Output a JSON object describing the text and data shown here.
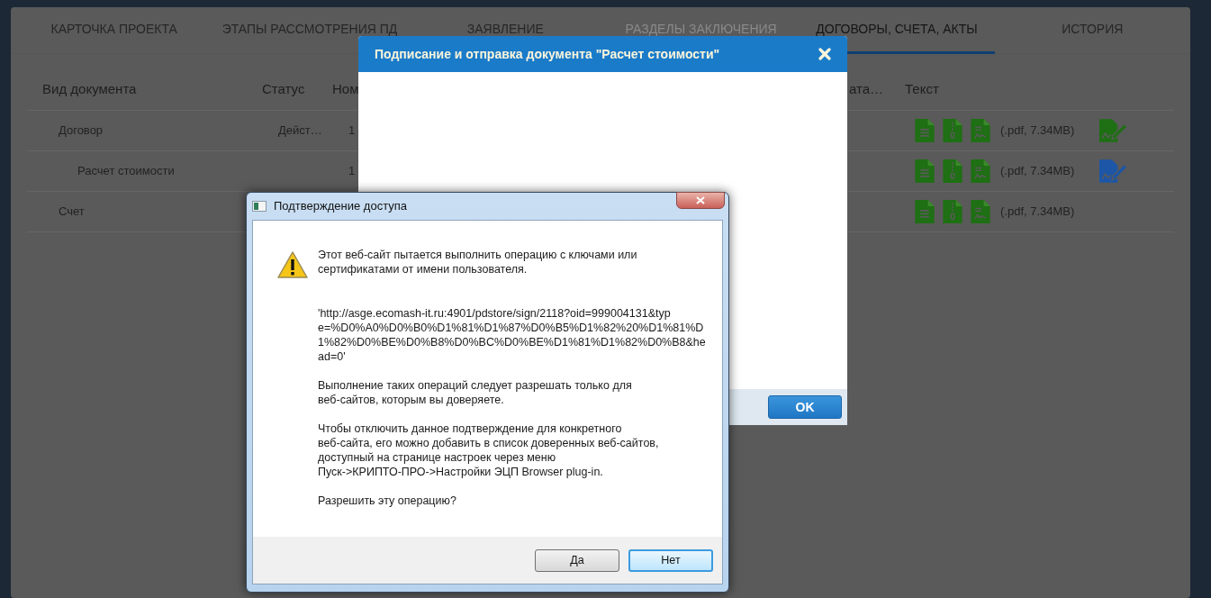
{
  "tabs": [
    {
      "label": "КАРТОЧКА ПРОЕКТА",
      "selected": false,
      "disabled": false
    },
    {
      "label": "ЭТАПЫ РАССМОТРЕНИЯ ПД",
      "selected": false,
      "disabled": false
    },
    {
      "label": "ЗАЯВЛЕНИЕ",
      "selected": false,
      "disabled": false
    },
    {
      "label": "РАЗДЕЛЫ ЗАКЛЮЧЕНИЯ",
      "selected": false,
      "disabled": true
    },
    {
      "label": "ДОГОВОРЫ, СЧЕТА, АКТЫ",
      "selected": true,
      "disabled": false
    },
    {
      "label": "ИСТОРИЯ",
      "selected": false,
      "disabled": false
    }
  ],
  "table": {
    "columns": [
      "Вид документа",
      "Статус",
      "Ном",
      "ата…",
      "Текст"
    ],
    "rows": [
      {
        "document_type": "Договор",
        "status": "Дейст…",
        "number": "1",
        "file_info": "(.pdf, 7.34MB)",
        "color": "#1f6f14",
        "children": [
          {
            "document_type": "Расчет стоимости",
            "number": "1",
            "file_info": "(.pdf, 7.34MB)",
            "color": "#1d56a6"
          }
        ]
      },
      {
        "document_type": "Счет",
        "file_info": "(.pdf, 7.34MB)"
      }
    ]
  },
  "sign_modal": {
    "title": "Подписание и отправка документа \"Расчет стоимости\"",
    "buttons": [
      "OK"
    ]
  },
  "confirm_dialog": {
    "title": "Подтверждение доступа",
    "paragraphs": [
      "Этот веб-сайт пытается выполнить операцию с ключами или\nсертификатами от имени пользователя.",
      "'http://asge.ecomash-it.ru:4901/pdstore/sign/2118?oid=999004131&typ\ne=%D0%A0%D0%B0%D1%81%D1%87%D0%B5%D1%82%20%D1%81%D\n1%82%D0%BE%D0%B8%D0%BC%D0%BE%D1%81%D1%82%D0%B8&he\nad=0'",
      "Выполнение таких операций следует разрешать только для\nвеб-сайтов, которым вы доверяете.",
      "Чтобы отключить данное подтверждение для конкретного\nвеб-сайта, его можно добавить в список доверенных веб-сайтов,\nдоступный на странице настроек через меню\nПуск->КРИПТО-ПРО->Настройки ЭЦП Browser plug-in.",
      "Разрешить эту операцию?"
    ],
    "buttons": [
      {
        "label": "Да",
        "focused": false
      },
      {
        "label": "Нет",
        "focused": true
      }
    ]
  }
}
